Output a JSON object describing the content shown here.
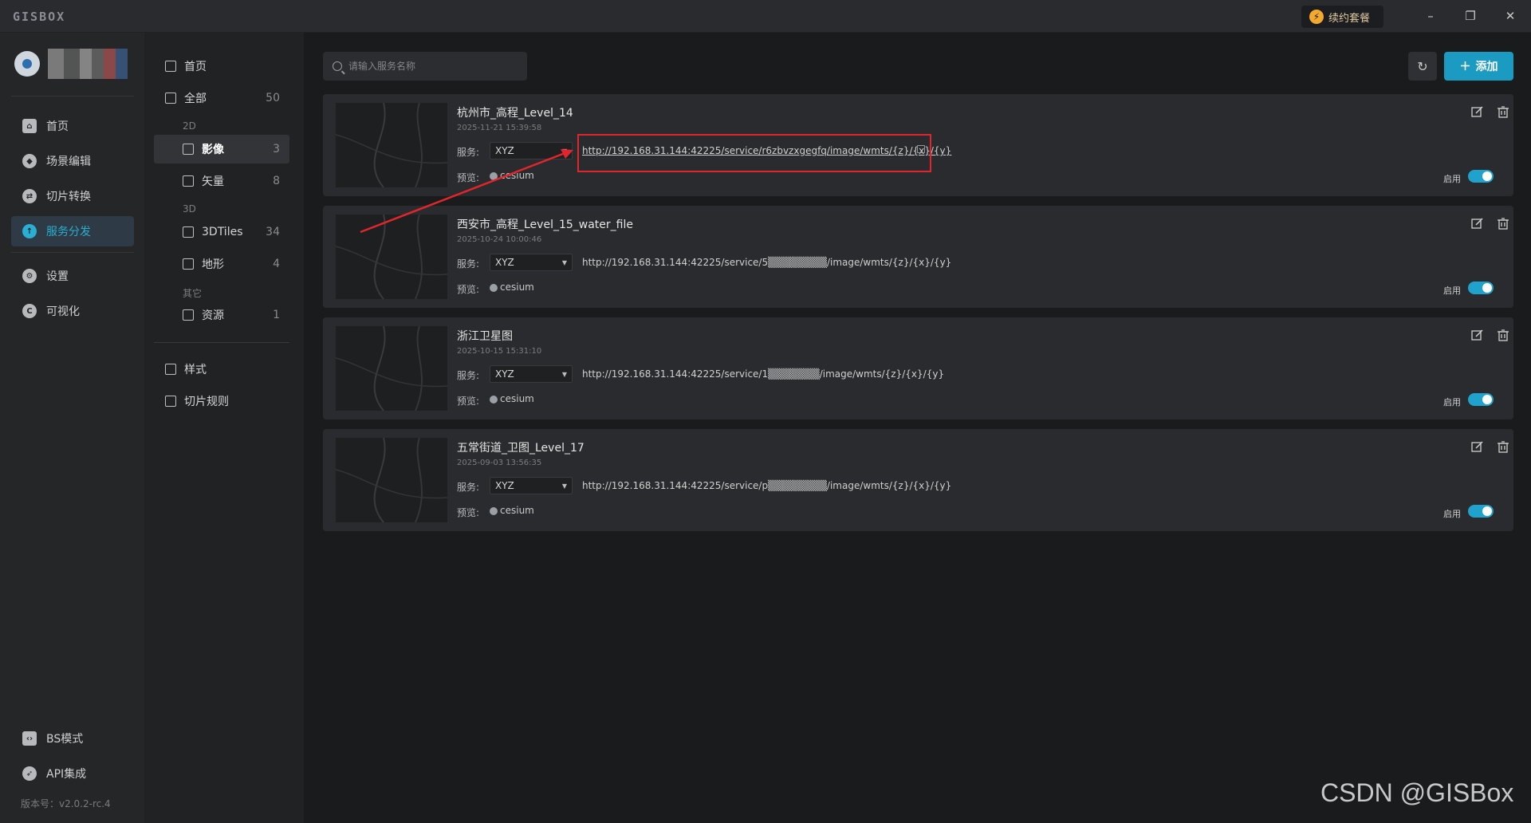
{
  "app": {
    "logo": "GISBOX",
    "renew_label": "续约套餐",
    "version": "版本号：v2.0.2-rc.4"
  },
  "window": {
    "minimize": "–",
    "restore": "❐",
    "close": "✕"
  },
  "leftnav": {
    "items": [
      {
        "label": "首页",
        "icon": "home-icon"
      },
      {
        "label": "场景编辑",
        "icon": "cube-icon"
      },
      {
        "label": "切片转换",
        "icon": "convert-icon"
      },
      {
        "label": "服务分发",
        "icon": "upload-icon",
        "active": true
      },
      {
        "label": "设置",
        "icon": "gear-icon"
      },
      {
        "label": "可视化",
        "icon": "visual-icon"
      }
    ],
    "bottom": [
      {
        "label": "BS模式",
        "icon": "code-icon"
      },
      {
        "label": "API集成",
        "icon": "rocket-icon"
      }
    ]
  },
  "catpanel": {
    "home": "首页",
    "all": {
      "label": "全部",
      "count": "50"
    },
    "group_2d": "2D",
    "imagery": {
      "label": "影像",
      "count": "3"
    },
    "vector": {
      "label": "矢量",
      "count": "8"
    },
    "group_3d": "3D",
    "tiles3d": {
      "label": "3DTiles",
      "count": "34"
    },
    "terrain": {
      "label": "地形",
      "count": "4"
    },
    "group_other": "其它",
    "resource": {
      "label": "资源",
      "count": "1"
    },
    "style": "样式",
    "tile_rule": "切片规则"
  },
  "toolbar": {
    "search_placeholder": "请输入服务名称",
    "add_label": "添加"
  },
  "cards": [
    {
      "title": "杭州市_高程_Level_14",
      "date": "2025-11-21 15:39:58",
      "service_label": "服务:",
      "service_type": "XYZ",
      "url": "http://192.168.31.144:42225/service/r6zbvzxgegfq/image/wmts/{z}/{x}/{y}",
      "preview_label": "预览:",
      "preview": "cesium",
      "enable_label": "启用"
    },
    {
      "title": "西安市_高程_Level_15_water_file",
      "date": "2025-10-24 10:00:46",
      "service_label": "服务:",
      "service_type": "XYZ",
      "url": "http://192.168.31.144:42225/service/5▒▒▒▒▒▒▒▒/image/wmts/{z}/{x}/{y}",
      "preview_label": "预览:",
      "preview": "cesium",
      "enable_label": "启用"
    },
    {
      "title": "浙江卫星图",
      "date": "2025-10-15 15:31:10",
      "service_label": "服务:",
      "service_type": "XYZ",
      "url": "http://192.168.31.144:42225/service/1▒▒▒▒▒▒▒/image/wmts/{z}/{x}/{y}",
      "preview_label": "预览:",
      "preview": "cesium",
      "enable_label": "启用"
    },
    {
      "title": "五常街道_卫图_Level_17",
      "date": "2025-09-03 13:56:35",
      "service_label": "服务:",
      "service_type": "XYZ",
      "url": "http://192.168.31.144:42225/service/p▒▒▒▒▒▒▒▒/image/wmts/{z}/{x}/{y}",
      "preview_label": "预览:",
      "preview": "cesium",
      "enable_label": "启用"
    }
  ],
  "watermark": "CSDN @GISBox",
  "colors": {
    "accent": "#1b9ac2",
    "highlight": "#e0262d"
  }
}
